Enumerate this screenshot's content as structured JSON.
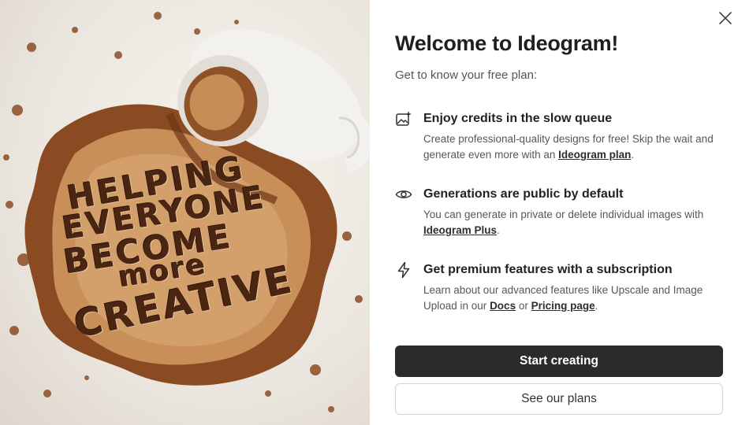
{
  "dialog": {
    "title": "Welcome to Ideogram!",
    "subtitle": "Get to know your free plan:",
    "close_icon": "close-icon"
  },
  "illustration": {
    "lines": [
      "HELPING",
      "EVERYONE",
      "BECOME",
      "more",
      "CREATIVE"
    ],
    "colors": {
      "background": "#ebe6df",
      "coffee": "#8a4a22",
      "foam": "#c98f58",
      "cup": "#f4f4f2"
    }
  },
  "features": [
    {
      "icon": "image-sparkle-icon",
      "title": "Enjoy credits in the slow queue",
      "desc_before": "Create professional-quality designs for free! Skip the wait and generate even more with an ",
      "link1": "Ideogram plan",
      "desc_after": "."
    },
    {
      "icon": "eye-icon",
      "title": "Generations are public by default",
      "desc_before": "You can generate in private or delete individual images with ",
      "link1": "Ideogram Plus",
      "desc_after": "."
    },
    {
      "icon": "lightning-icon",
      "title": "Get premium features with a subscription",
      "desc_before": "Learn about our advanced features like Upscale and Image Upload in our ",
      "link1": "Docs",
      "desc_middle": " or ",
      "link2": "Pricing page",
      "desc_after": "."
    }
  ],
  "actions": {
    "primary_label": "Start creating",
    "secondary_label": "See our plans"
  },
  "colors": {
    "primary_button": "#2b2b2c",
    "text": "#222222",
    "muted_text": "#575757"
  }
}
